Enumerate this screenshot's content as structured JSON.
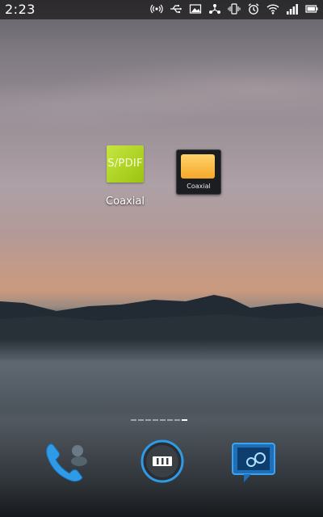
{
  "status_bar": {
    "time": "2:23",
    "icons": [
      "hotspot-icon",
      "usb-icon",
      "image-icon",
      "share-icon",
      "vibrate-icon",
      "alarm-icon",
      "wifi-icon",
      "signal-icon",
      "battery-icon"
    ]
  },
  "home": {
    "apps": [
      {
        "icon_text": "S/PDIF",
        "label": "Coaxial",
        "color": "#b4d92a"
      }
    ],
    "widget": {
      "label": "Coaxial",
      "color": "#f7b541"
    },
    "page_indicator": {
      "pages": 8,
      "current": 8
    }
  },
  "dock": {
    "items": [
      "phone-icon",
      "app-drawer-icon",
      "messaging-icon"
    ]
  }
}
